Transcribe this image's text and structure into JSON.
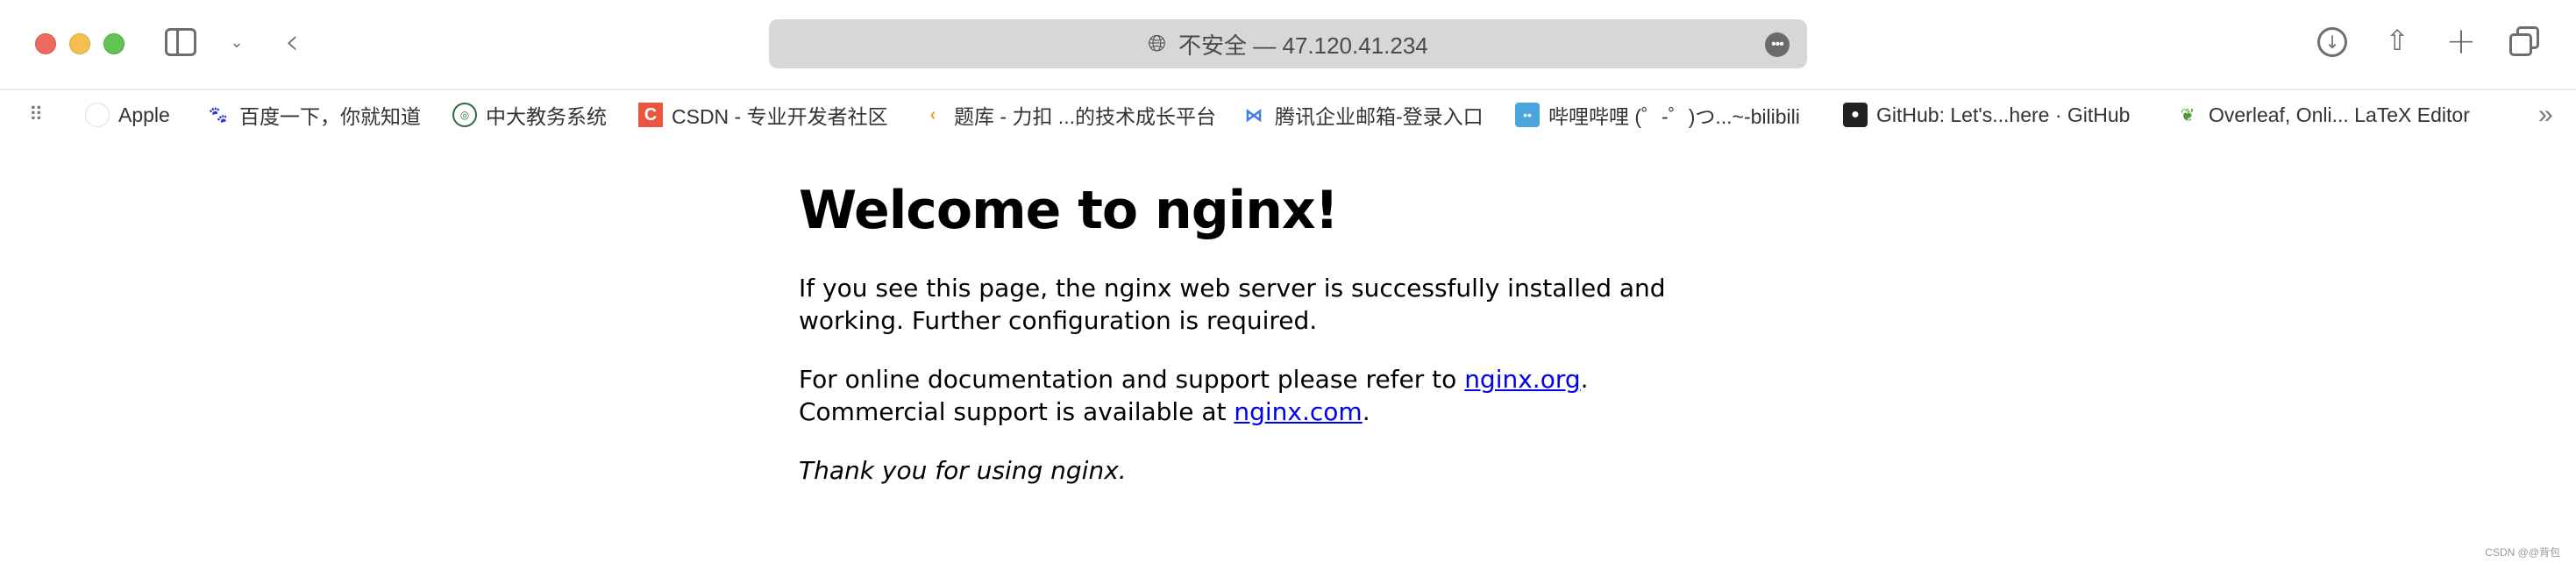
{
  "browser": {
    "address": "不安全 — 47.120.41.234",
    "bookmarks": [
      {
        "label": "Apple",
        "icon": "apple-icon"
      },
      {
        "label": "百度一下，你就知道",
        "icon": "baidu-icon"
      },
      {
        "label": "中大教务系统",
        "icon": "university-seal-icon"
      },
      {
        "label": "CSDN - 专业开发者社区",
        "icon": "csdn-icon"
      },
      {
        "label": "题库 - 力扣 ...的技术成长平台",
        "icon": "leetcode-icon"
      },
      {
        "label": "腾讯企业邮箱-登录入口",
        "icon": "tencent-mail-icon"
      },
      {
        "label": "哔哩哔哩 (゜-゜)つ...~-bilibili",
        "icon": "bilibili-icon"
      },
      {
        "label": "GitHub: Let's...here · GitHub",
        "icon": "github-icon"
      },
      {
        "label": "Overleaf, Onli... LaTeX Editor",
        "icon": "overleaf-icon"
      }
    ]
  },
  "page": {
    "title": "Welcome to nginx!",
    "p1": "If you see this page, the nginx web server is successfully installed and working. Further configuration is required.",
    "p2_prefix": "For online documentation and support please refer to ",
    "p2_link": "nginx.org",
    "p2_mid": ".",
    "p3_prefix": "Commercial support is available at ",
    "p3_link": "nginx.com",
    "p3_suffix": ".",
    "p4": "Thank you for using nginx."
  },
  "watermark": "CSDN @@背包"
}
